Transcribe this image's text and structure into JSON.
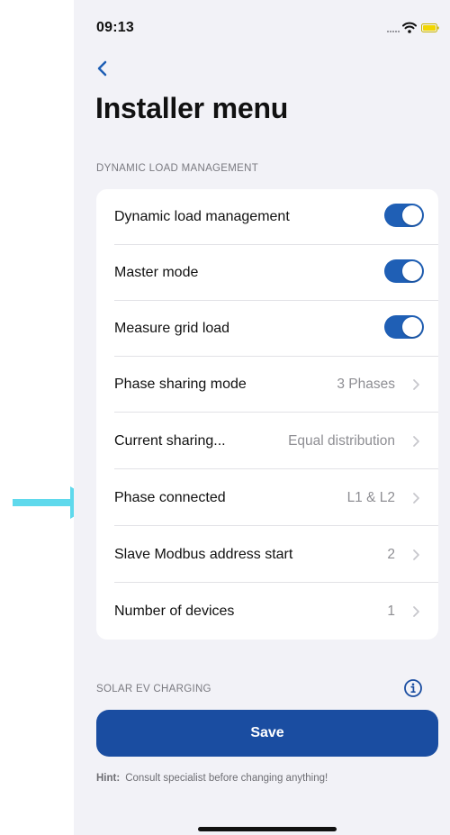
{
  "status_bar": {
    "time": "09:13"
  },
  "header": {
    "title": "Installer menu"
  },
  "sections": {
    "dlm_header": "DYNAMIC LOAD MANAGEMENT",
    "solar_header": "SOLAR EV CHARGING"
  },
  "rows": [
    {
      "label": "Dynamic load management",
      "type": "toggle",
      "on": true
    },
    {
      "label": "Master mode",
      "type": "toggle",
      "on": true
    },
    {
      "label": "Measure grid load",
      "type": "toggle",
      "on": true
    },
    {
      "label": "Phase sharing mode",
      "type": "value",
      "value": "3 Phases"
    },
    {
      "label": "Current sharing...",
      "type": "value",
      "value": "Equal distribution"
    },
    {
      "label": "Phase connected",
      "type": "value",
      "value": "L1 & L2"
    },
    {
      "label": "Slave Modbus address start",
      "type": "value",
      "value": "2"
    },
    {
      "label": "Number of devices",
      "type": "value",
      "value": "1"
    }
  ],
  "save_button": {
    "label": "Save"
  },
  "hint": {
    "label": "Hint:",
    "text": "Consult specialist before changing anything!"
  },
  "colors": {
    "accent": "#1f5fb5",
    "save_button": "#1a4da1",
    "annotation_arrow": "#5fd9ec",
    "background": "#f2f2f7"
  },
  "icons": [
    "back-chevron-icon",
    "signal-icon",
    "wifi-icon",
    "battery-icon",
    "chevron-right-icon",
    "info-icon"
  ]
}
